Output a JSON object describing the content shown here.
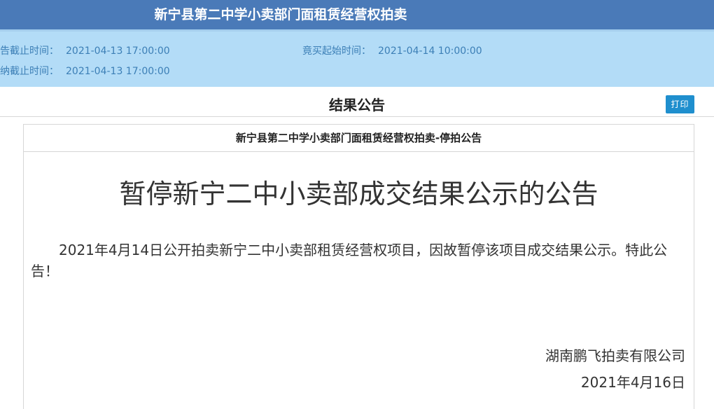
{
  "header": {
    "title": "新宁县第二中学小卖部门面租赁经营权拍卖"
  },
  "info": {
    "notice_deadline_label": "公告截止时间：",
    "notice_deadline_value": "2021-04-13 17:00:00",
    "payment_deadline_label": "缴纳截止时间：",
    "payment_deadline_value": "2021-04-13 17:00:00",
    "bid_start_label": "竟买起始时间：",
    "bid_start_value": "2021-04-14 10:00:00"
  },
  "result": {
    "title": "结果公告",
    "print_label": "打印"
  },
  "announcement": {
    "panel_title": "新宁县第二中学小卖部门面租赁经营权拍卖-停拍公告",
    "headline": "暂停新宁二中小卖部成交结果公示的公告",
    "body": "2021年4月14日公开拍卖新宁二中小卖部租赁经营权项目，因故暂停该项目成交结果公示。特此公告！",
    "company": "湖南鹏飞拍卖有限公司",
    "date": "2021年4月16日"
  },
  "colors": {
    "header_bg": "#4a7ab8",
    "info_bg": "#b3dcf7",
    "info_text": "#3c7fb6",
    "button_bg": "#1f8fce"
  }
}
